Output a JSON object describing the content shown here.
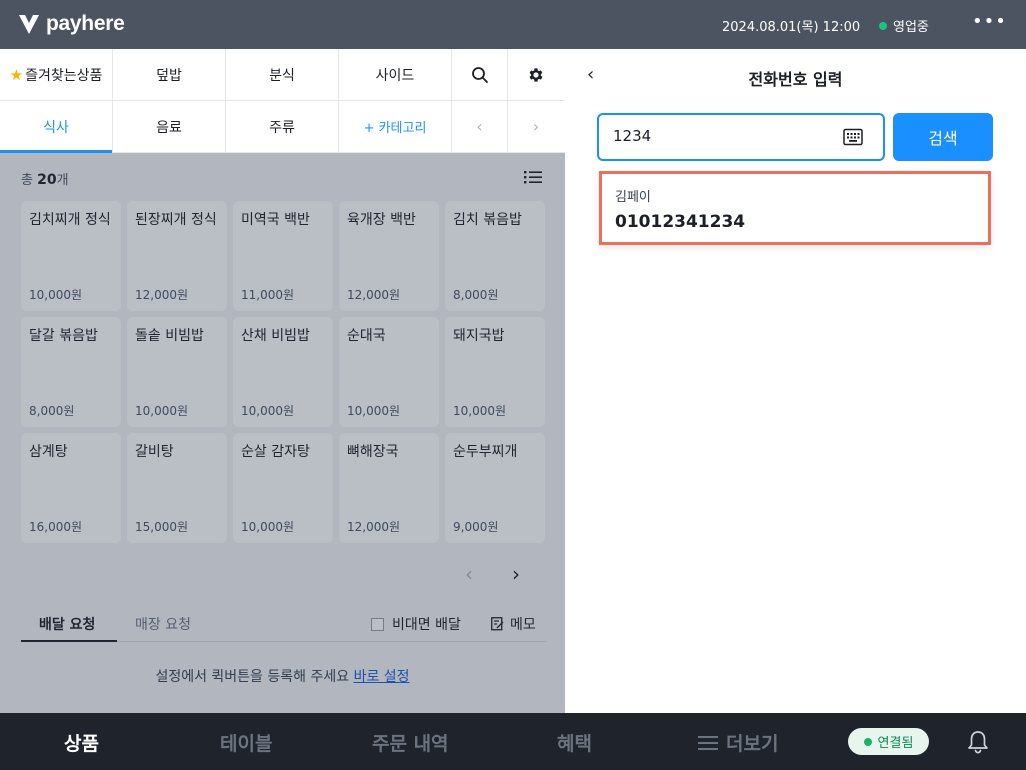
{
  "header": {
    "logo_text": "payhere",
    "datetime": "2024.08.01(목) 12:00",
    "status": "영업중",
    "more": "•••"
  },
  "categories": {
    "row1": [
      "즐겨찾는상품",
      "덮밥",
      "분식",
      "사이드"
    ],
    "row2": [
      "식사",
      "음료",
      "주류",
      "+ 카테고리"
    ],
    "active": "식사"
  },
  "products": {
    "total_prefix": "총",
    "total_count": "20",
    "total_suffix": "개",
    "items": [
      {
        "name": "김치찌개 정식",
        "price": "10,000원"
      },
      {
        "name": "된장찌개 정식",
        "price": "12,000원"
      },
      {
        "name": "미역국 백반",
        "price": "11,000원"
      },
      {
        "name": "육개장 백반",
        "price": "12,000원"
      },
      {
        "name": "김치 볶음밥",
        "price": "8,000원"
      },
      {
        "name": "달갈 볶음밥",
        "price": "8,000원"
      },
      {
        "name": "돌솥 비빔밥",
        "price": "10,000원"
      },
      {
        "name": "산채 비빔밥",
        "price": "10,000원"
      },
      {
        "name": "순대국",
        "price": "10,000원"
      },
      {
        "name": "돼지국밥",
        "price": "10,000원"
      },
      {
        "name": "삼계탕",
        "price": "16,000원"
      },
      {
        "name": "갈비탕",
        "price": "15,000원"
      },
      {
        "name": "순살 감자탕",
        "price": "10,000원"
      },
      {
        "name": "뼈해장국",
        "price": "12,000원"
      },
      {
        "name": "순두부찌개",
        "price": "9,000원"
      }
    ]
  },
  "request": {
    "tab1": "배달 요청",
    "tab2": "매장 요청",
    "contactless": "비대면 배달",
    "memo": "메모",
    "quick_text": "설정에서 퀵버튼을 등록해 주세요",
    "quick_link": "바로 설정"
  },
  "phone_panel": {
    "title": "전화번호 입력",
    "input_value": "1234",
    "search_label": "검색",
    "result_name": "김페이",
    "result_phone": "01012341234"
  },
  "bottom_nav": {
    "items": [
      "상품",
      "테이블",
      "주문 내역",
      "혜택",
      "더보기"
    ],
    "active": "상품",
    "connection": "연결됨"
  },
  "colors": {
    "accent": "#1a8fff",
    "header_bg": "#4c5461",
    "bottom_bg": "#1f232b",
    "highlight_border": "#e8705d",
    "status_green": "#19c37d"
  }
}
